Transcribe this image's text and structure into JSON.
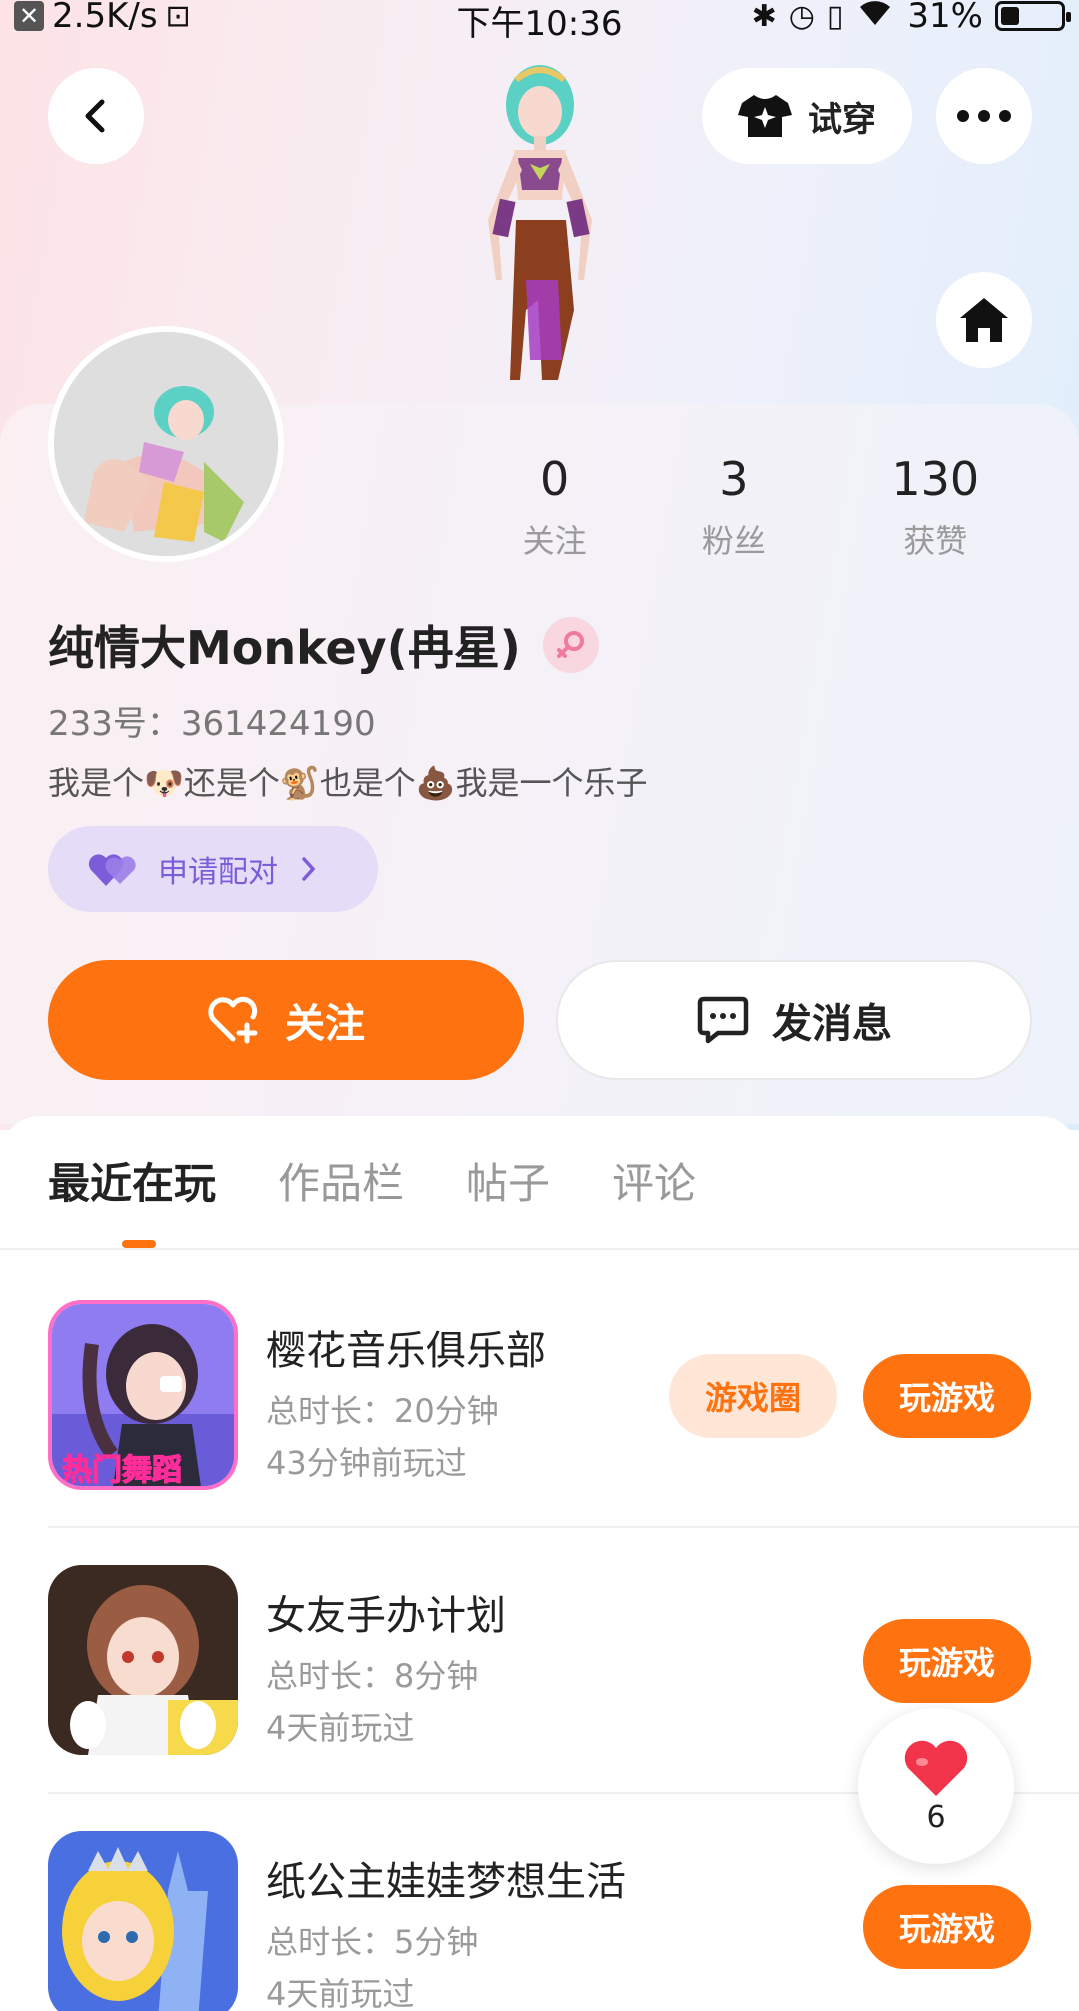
{
  "status_bar": {
    "speed": "2.5K/s",
    "time": "下午10:36",
    "battery": "31%",
    "battery_level": 0.31
  },
  "header": {
    "try_on_label": "试穿"
  },
  "profile": {
    "stats": [
      {
        "value": "0",
        "label": "关注"
      },
      {
        "value": "3",
        "label": "粉丝"
      },
      {
        "value": "130",
        "label": "获赞"
      }
    ],
    "username": "纯情大Monkey(冉星)",
    "uid": "233号：361424190",
    "bio": "我是个🐶还是个🐒也是个💩我是一个乐子",
    "pair_label": "申请配对",
    "follow_label": "关注",
    "message_label": "发消息"
  },
  "tabs": [
    {
      "label": "最近在玩",
      "active": true
    },
    {
      "label": "作品栏",
      "active": false
    },
    {
      "label": "帖子",
      "active": false
    },
    {
      "label": "评论",
      "active": false
    }
  ],
  "games": [
    {
      "name": "樱花音乐俱乐部",
      "duration": "总时长：20分钟",
      "last_played": "43分钟前玩过",
      "circle_label": "游戏圈",
      "play_label": "玩游戏",
      "icon_badge": "热门舞蹈"
    },
    {
      "name": "女友手办计划",
      "duration": "总时长：8分钟",
      "last_played": "4天前玩过",
      "play_label": "玩游戏"
    },
    {
      "name": "纸公主娃娃梦想生活",
      "duration": "总时长：5分钟",
      "last_played": "4天前玩过",
      "play_label": "玩游戏"
    }
  ],
  "like_float": {
    "count": "6"
  },
  "colors": {
    "accent": "#ff7210",
    "pair_purple": "#7d5cd9",
    "gender_pink": "#f07aa0"
  }
}
